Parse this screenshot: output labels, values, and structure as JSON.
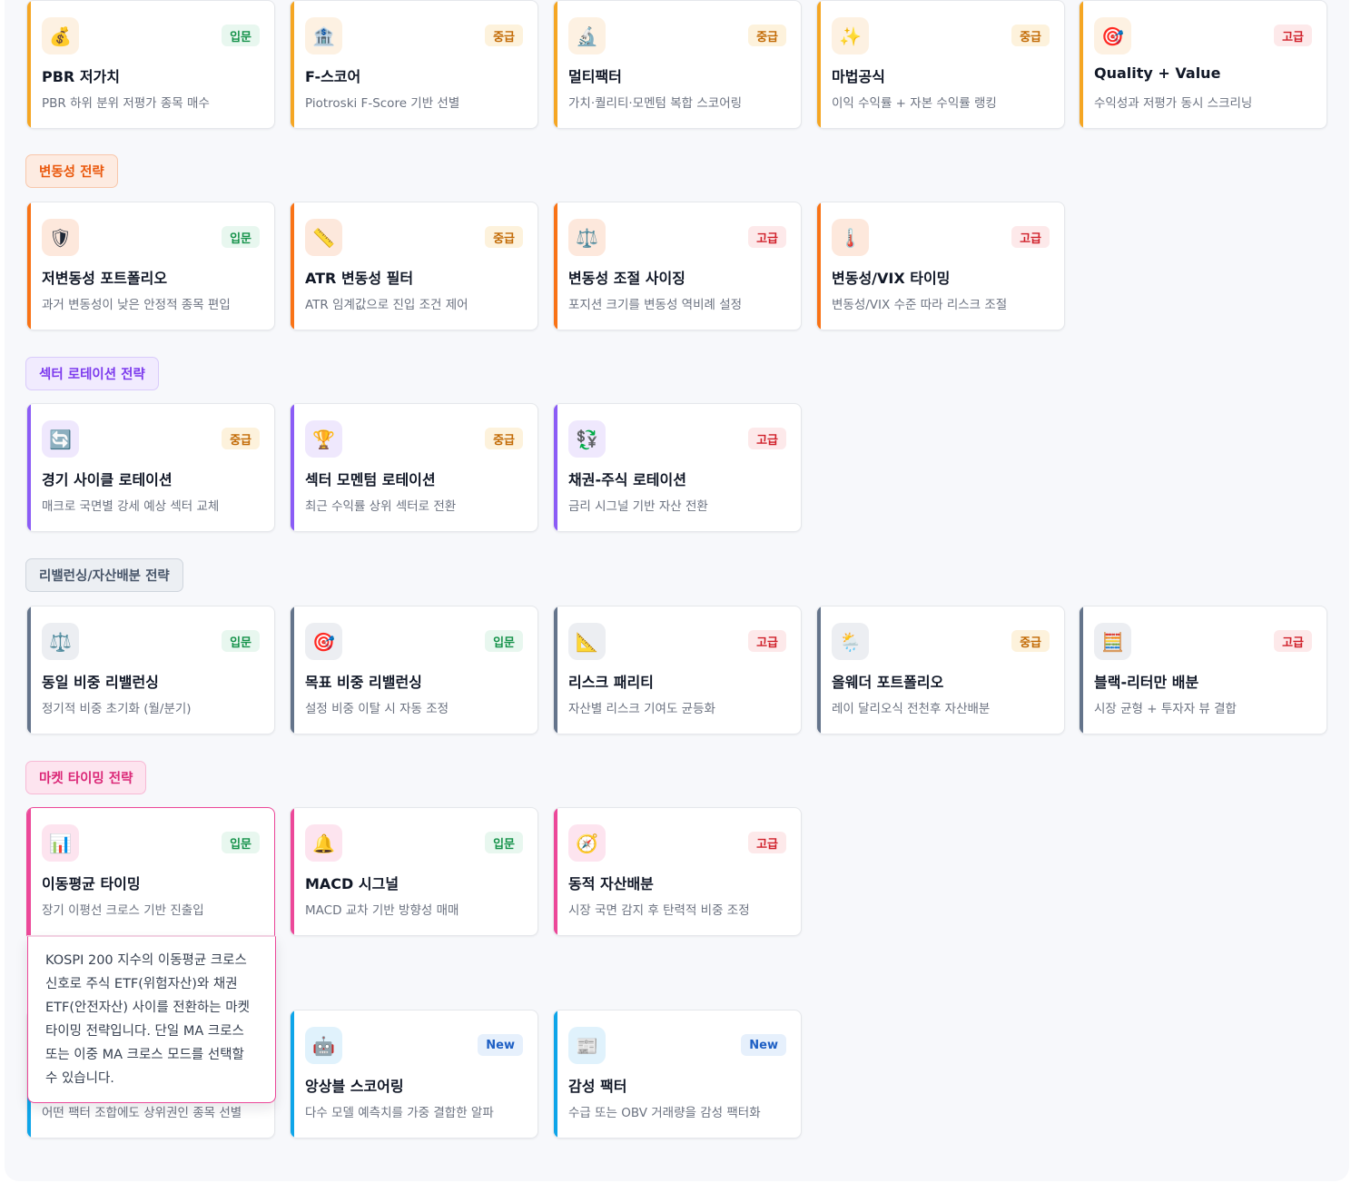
{
  "levels": {
    "intro": "입문",
    "mid": "중급",
    "adv": "고급",
    "new": "New"
  },
  "colors": {
    "value": "#f5a623",
    "volatility": "#f97316",
    "sector": "#8b5cf6",
    "rebalance": "#64748b",
    "timing": "#ec4899",
    "factor": "#0ea5e9"
  },
  "sections": {
    "volatility": "변동성 전략",
    "sector": "섹터 로테이션 전략",
    "rebalance": "리밸런싱/자산배분 전략",
    "timing": "마켓 타이밍 전략"
  },
  "value_cards": [
    {
      "icon": "money-bag-icon",
      "glyph": "💰",
      "level": "입문",
      "title": "PBR 저가치",
      "desc": "PBR 하위 분위 저평가 종목 매수"
    },
    {
      "icon": "bank-icon",
      "glyph": "🏦",
      "level": "중급",
      "title": "F-스코어",
      "desc": "Piotroski F-Score 기반 선별"
    },
    {
      "icon": "microscope-icon",
      "glyph": "🔬",
      "level": "중급",
      "title": "멀티팩터",
      "desc": "가치·퀄리티·모멘텀 복합 스코어링"
    },
    {
      "icon": "sparkles-icon",
      "glyph": "✨",
      "level": "중급",
      "title": "마법공식",
      "desc": "이익 수익률 + 자본 수익률 랭킹"
    },
    {
      "icon": "target-icon",
      "glyph": "🎯",
      "level": "고급",
      "title": "Quality + Value",
      "desc": "수익성과 저평가 동시 스크리닝"
    }
  ],
  "volatility_cards": [
    {
      "icon": "shield-icon",
      "glyph": "🛡",
      "level": "입문",
      "title": "저변동성 포트폴리오",
      "desc": "과거 변동성이 낮은 안정적 종목 편입"
    },
    {
      "icon": "ruler-icon",
      "glyph": "📏",
      "level": "중급",
      "title": "ATR 변동성 필터",
      "desc": "ATR 임계값으로 진입 조건 제어"
    },
    {
      "icon": "scales-icon",
      "glyph": "⚖️",
      "level": "고급",
      "title": "변동성 조절 사이징",
      "desc": "포지션 크기를 변동성 역비례 설정"
    },
    {
      "icon": "thermometer-icon",
      "glyph": "🌡️",
      "level": "고급",
      "title": "변동성/VIX 타이밍",
      "desc": "변동성/VIX 수준 따라 리스크 조절"
    }
  ],
  "sector_cards": [
    {
      "icon": "cycle-arrows-icon",
      "glyph": "🔄",
      "level": "중급",
      "title": "경기 사이클 로테이션",
      "desc": "매크로 국면별 강세 예상 섹터 교체"
    },
    {
      "icon": "trophy-icon",
      "glyph": "🏆",
      "level": "중급",
      "title": "섹터 모멘텀 로테이션",
      "desc": "최근 수익률 상위 섹터로 전환"
    },
    {
      "icon": "currency-exchange-icon",
      "glyph": "💱",
      "level": "고급",
      "title": "채권-주식 로테이션",
      "desc": "금리 시그널 기반 자산 전환"
    }
  ],
  "rebalance_cards": [
    {
      "icon": "scales-icon",
      "glyph": "⚖️",
      "level": "입문",
      "title": "동일 비중 리밸런싱",
      "desc": "정기적 비중 초기화 (월/분기)"
    },
    {
      "icon": "target-icon",
      "glyph": "🎯",
      "level": "입문",
      "title": "목표 비중 리밸런싱",
      "desc": "설정 비중 이탈 시 자동 조정"
    },
    {
      "icon": "triangular-ruler-icon",
      "glyph": "📐",
      "level": "고급",
      "title": "리스크 패리티",
      "desc": "자산별 리스크 기여도 균등화"
    },
    {
      "icon": "sun-rain-cloud-icon",
      "glyph": "🌦️",
      "level": "중급",
      "title": "올웨더 포트폴리오",
      "desc": "레이 달리오식 전천후 자산배분"
    },
    {
      "icon": "abacus-icon",
      "glyph": "🧮",
      "level": "고급",
      "title": "블랙-리터만 배분",
      "desc": "시장 균형 + 투자자 뷰 결합"
    }
  ],
  "timing_cards": [
    {
      "icon": "bar-chart-icon",
      "glyph": "📊",
      "level": "입문",
      "title": "이동평균 타이밍",
      "desc": "장기 이평선 크로스 기반 진출입"
    },
    {
      "icon": "bell-icon",
      "glyph": "🔔",
      "level": "입문",
      "title": "MACD 시그널",
      "desc": "MACD 교차 기반 방향성 매매"
    },
    {
      "icon": "compass-icon",
      "glyph": "🧭",
      "level": "고급",
      "title": "동적 자산배분",
      "desc": "시장 국면 감지 후 탄력적 비중 조정"
    }
  ],
  "tooltip_text": "KOSPI 200 지수의 이동평균 크로스 신호로 주식 ETF(위험자산)와 채권 ETF(안전자산) 사이를 전환하는 마켓 타이밍 전략입니다. 단일 MA 크로스 또는 이중 MA 크로스 모드를 선택할 수 있습니다.",
  "factor_cards": [
    {
      "icon": "",
      "glyph": "",
      "level": "",
      "title": "",
      "desc": "어떤 팩터 조합에도 상위권인 종목 선별"
    },
    {
      "icon": "robot-icon",
      "glyph": "🤖",
      "level": "New",
      "title": "앙상블 스코어링",
      "desc": "다수 모델 예측치를 가중 결합한 알파"
    },
    {
      "icon": "newspaper-icon",
      "glyph": "📰",
      "level": "New",
      "title": "감성 팩터",
      "desc": "수급 또는 OBV 거래량을 감성 팩터화"
    }
  ]
}
